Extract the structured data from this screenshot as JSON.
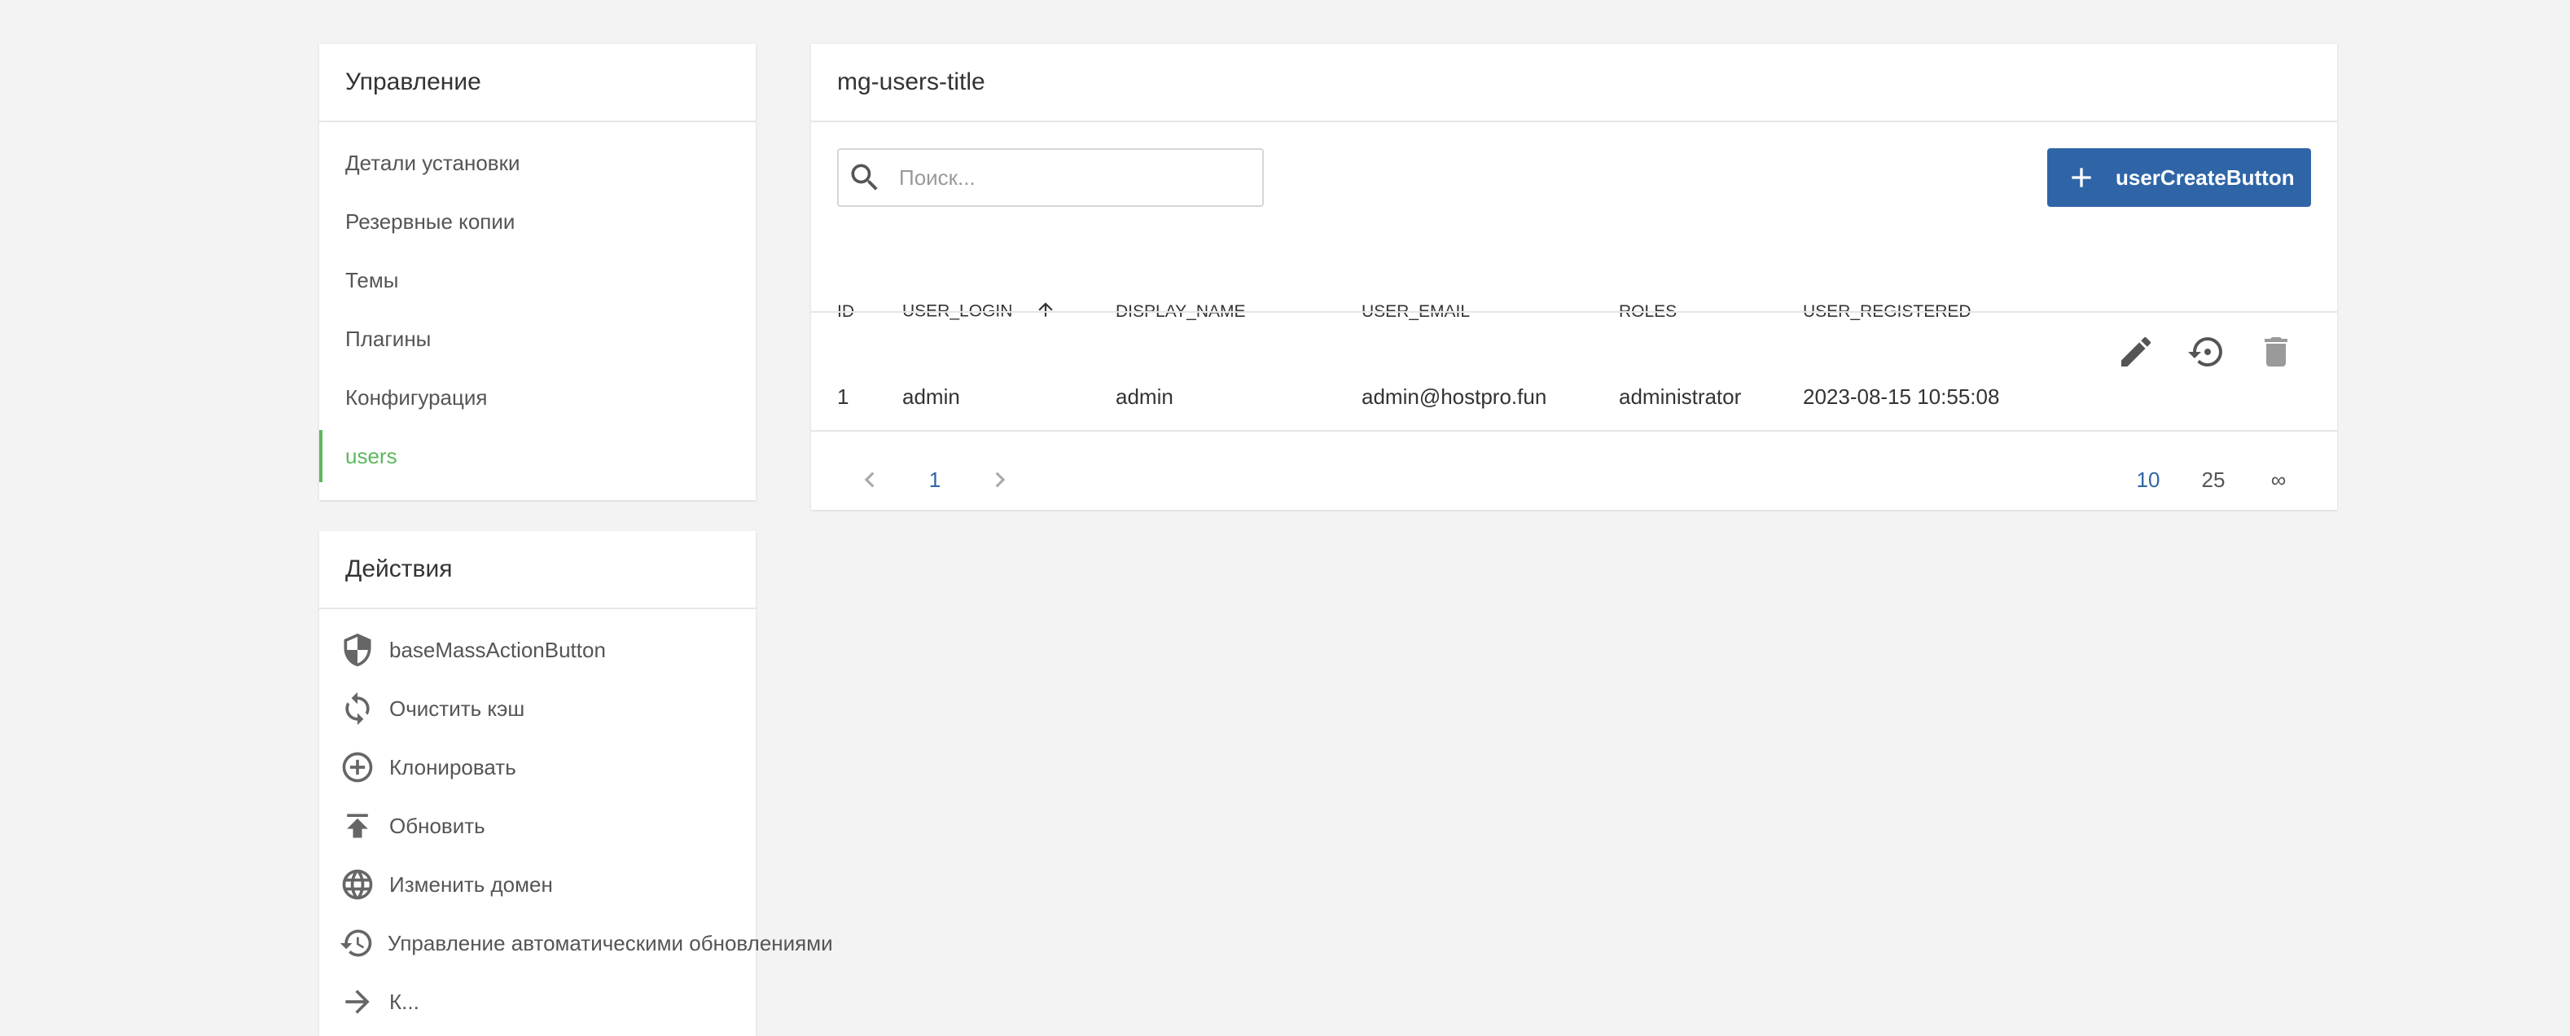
{
  "management": {
    "title": "Управление",
    "items": [
      {
        "label": "Детали установки"
      },
      {
        "label": "Резервные копии"
      },
      {
        "label": "Темы"
      },
      {
        "label": "Плагины"
      },
      {
        "label": "Конфигурация"
      },
      {
        "label": "users",
        "active": true
      }
    ]
  },
  "actions": {
    "title": "Действия",
    "items": [
      {
        "label": "baseMassActionButton",
        "icon": "shield-icon"
      },
      {
        "label": "Очистить кэш",
        "icon": "refresh-icon"
      },
      {
        "label": "Клонировать",
        "icon": "clone-icon"
      },
      {
        "label": "Обновить",
        "icon": "upload-icon"
      },
      {
        "label": "Изменить домен",
        "icon": "globe-icon"
      },
      {
        "label": "Управление автоматическими обновлениями",
        "icon": "history-icon"
      },
      {
        "label": "К...",
        "icon": "arrow-right-icon"
      }
    ]
  },
  "main": {
    "title": "mg-users-title",
    "search": {
      "placeholder": "Поиск...",
      "value": ""
    },
    "create_button": "userCreateButton",
    "columns": [
      "ID",
      "USER_LOGIN",
      "DISPLAY_NAME",
      "USER_EMAIL",
      "ROLES",
      "USER_REGISTERED"
    ],
    "sort_column": "USER_LOGIN",
    "rows": [
      {
        "id": "1",
        "login": "admin",
        "display_name": "admin",
        "email": "admin@hostpro.fun",
        "roles": "administrator",
        "registered": "2023-08-15 10:55:08"
      }
    ],
    "pagination": {
      "current_page": "1"
    },
    "per_page": [
      "10",
      "25",
      "∞"
    ],
    "per_page_selected": "10"
  },
  "colors": {
    "accent": "#2f65a7",
    "active_nav": "#5cb85c",
    "background": "#f3f3f3"
  }
}
